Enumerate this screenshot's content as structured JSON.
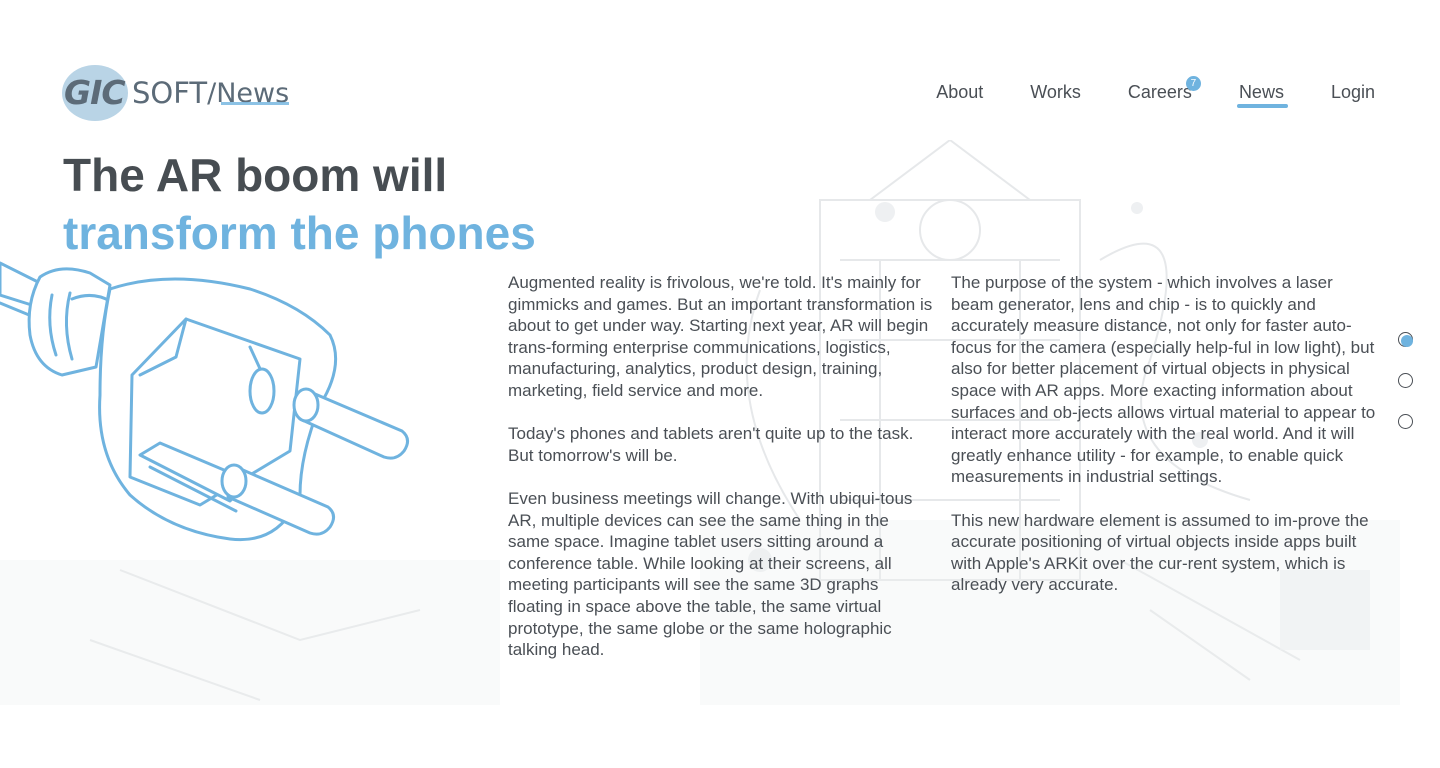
{
  "header": {
    "logo": {
      "badge_text": "GIC",
      "soft_text": "SOFT",
      "section_text": "/News"
    },
    "nav": [
      {
        "label": "About",
        "active": false
      },
      {
        "label": "Works",
        "active": false
      },
      {
        "label": "Careers",
        "active": false,
        "badge": "7"
      },
      {
        "label": "News",
        "active": true
      },
      {
        "label": "Login",
        "active": false
      }
    ]
  },
  "article": {
    "title_line1": "The AR boom will",
    "title_line2": "transform the phones",
    "left_column": [
      "Augmented reality is frivolous, we're told. It's mainly for gimmicks and games. But an important transformation is about to get under way. Starting next year, AR will begin trans-forming enterprise communications, logistics, manufacturing, analytics, product design, training, marketing, field service and more.",
      "Today's phones and tablets aren't quite up to the task. But tomorrow's will be.",
      "Even business meetings will change. With ubiqui-tous AR, multiple devices can see the same thing in the same space. Imagine tablet users sitting around a conference table. While looking at their screens, all meeting participants will see the same 3D graphs floating in space above the table, the same virtual prototype, the same globe or the same holographic talking head."
    ],
    "right_column": [
      "The purpose of the system - which involves a laser beam generator, lens and chip - is to quickly and accurately measure distance, not only for faster auto-focus for the camera (especially help-ful in low light), but also for better placement of virtual objects in physical space with AR apps. More exacting information about surfaces and ob-jects allows virtual material to appear to interact more accurately with the real world. And it will greatly enhance utility - for example, to enable quick measurements in industrial settings.",
      "This new hardware element is assumed to im-prove the accurate positioning of virtual objects inside apps built with Apple's ARKit over the cur-rent system, which is already very accurate."
    ]
  },
  "pager": {
    "count": 3,
    "active_index": 0
  },
  "colors": {
    "accent": "#6fb3df",
    "text": "#4a4f55",
    "heading": "#474d52",
    "logo_badge": "#b9d4e6"
  },
  "icons": {
    "illustration": "electric-plug-icon",
    "background": "building-sketch"
  }
}
